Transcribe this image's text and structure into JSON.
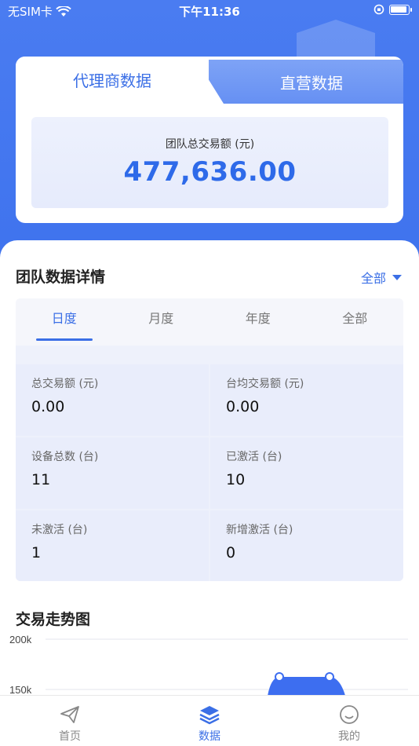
{
  "status_bar": {
    "carrier": "无SIM卡",
    "time": "下午11:36"
  },
  "top_tabs": {
    "agent": "代理商数据",
    "direct": "直营数据"
  },
  "summary": {
    "label": "团队总交易额 (元)",
    "value": "477,636.00"
  },
  "team_detail": {
    "title": "团队数据详情",
    "filter": "全部",
    "period_tabs": [
      "日度",
      "月度",
      "年度",
      "全部"
    ],
    "stats": [
      {
        "label": "总交易额 (元)",
        "value": "0.00"
      },
      {
        "label": "台均交易额 (元)",
        "value": "0.00"
      },
      {
        "label": "设备总数 (台)",
        "value": "11"
      },
      {
        "label": "已激活 (台)",
        "value": "10"
      },
      {
        "label": "未激活 (台)",
        "value": "1"
      },
      {
        "label": "新增激活 (台)",
        "value": "0"
      }
    ]
  },
  "trend": {
    "title": "交易走势图",
    "y_ticks": [
      "200k",
      "150k"
    ]
  },
  "nav": {
    "home": "首页",
    "data": "数据",
    "mine": "我的"
  },
  "colors": {
    "primary": "#3b6fe6",
    "hero": "#4a7cf1"
  }
}
